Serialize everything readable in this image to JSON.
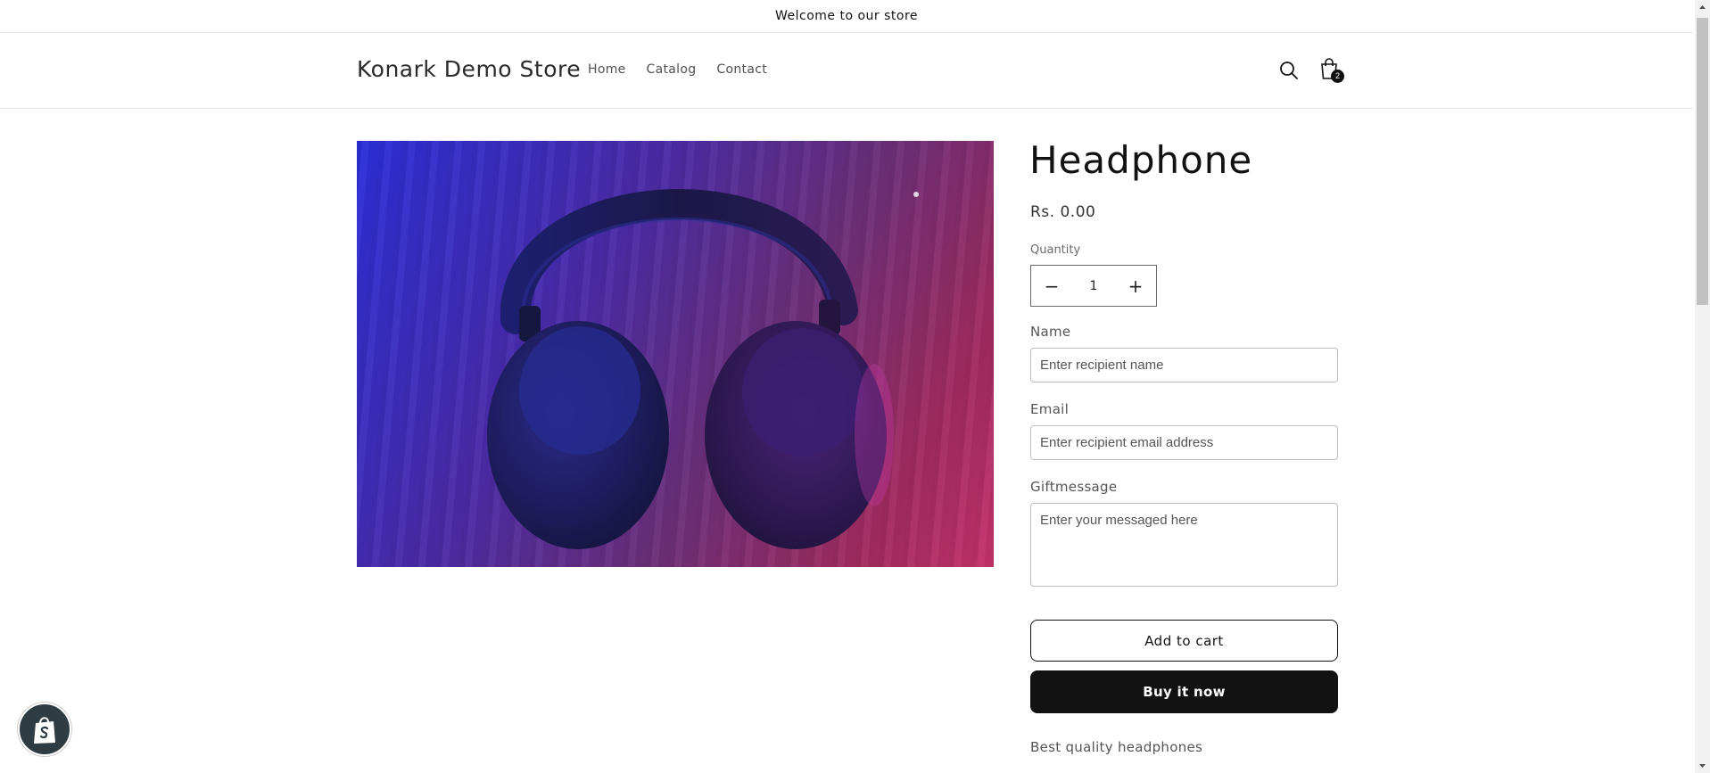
{
  "announcement": {
    "text": "Welcome to our store"
  },
  "header": {
    "store_name": "Konark Demo Store",
    "nav": [
      {
        "label": "Home"
      },
      {
        "label": "Catalog"
      },
      {
        "label": "Contact"
      }
    ],
    "search_icon": "search-icon",
    "cart_icon": "cart-icon",
    "cart_count": "2"
  },
  "product": {
    "image_alt": "Black over-ear headphones on a wooden surface lit with blue and pink light",
    "title": "Headphone",
    "price": "Rs. 0.00",
    "quantity": {
      "label": "Quantity",
      "value": "1",
      "minus": "−",
      "plus": "+"
    },
    "fields": {
      "name_label": "Name",
      "name_placeholder": "Enter recipient name",
      "email_label": "Email",
      "email_placeholder": "Enter recipient email address",
      "message_label": "Giftmessage",
      "message_placeholder": "Enter your messaged here"
    },
    "add_to_cart": "Add to cart",
    "buy_now": "Buy it now",
    "description": "Best quality headphones"
  },
  "colors": {
    "primary_button": "#121212",
    "text": "#121212",
    "shopify_badge": "#2f3c43"
  }
}
